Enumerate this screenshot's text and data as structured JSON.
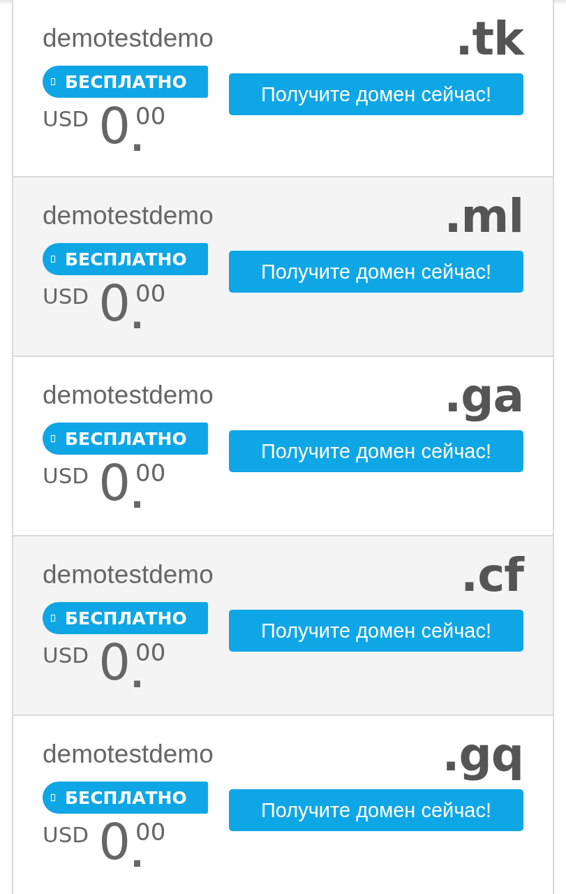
{
  "domains": [
    {
      "name": "demotestdemo",
      "tld": ".tk",
      "badge": "БЕСПЛАТНО",
      "currency": "USD",
      "price_whole": "0",
      "price_dot": ".",
      "price_cents": "00",
      "button": "Получите домен сейчас!"
    },
    {
      "name": "demotestdemo",
      "tld": ".ml",
      "badge": "БЕСПЛАТНО",
      "currency": "USD",
      "price_whole": "0",
      "price_dot": ".",
      "price_cents": "00",
      "button": "Получите домен сейчас!"
    },
    {
      "name": "demotestdemo",
      "tld": ".ga",
      "badge": "БЕСПЛАТНО",
      "currency": "USD",
      "price_whole": "0",
      "price_dot": ".",
      "price_cents": "00",
      "button": "Получите домен сейчас!"
    },
    {
      "name": "demotestdemo",
      "tld": ".cf",
      "badge": "БЕСПЛАТНО",
      "currency": "USD",
      "price_whole": "0",
      "price_dot": ".",
      "price_cents": "00",
      "button": "Получите домен сейчас!"
    },
    {
      "name": "demotestdemo",
      "tld": ".gq",
      "badge": "БЕСПЛАТНО",
      "currency": "USD",
      "price_whole": "0",
      "price_dot": ".",
      "price_cents": "00",
      "button": "Получите домен сейчас!"
    }
  ]
}
